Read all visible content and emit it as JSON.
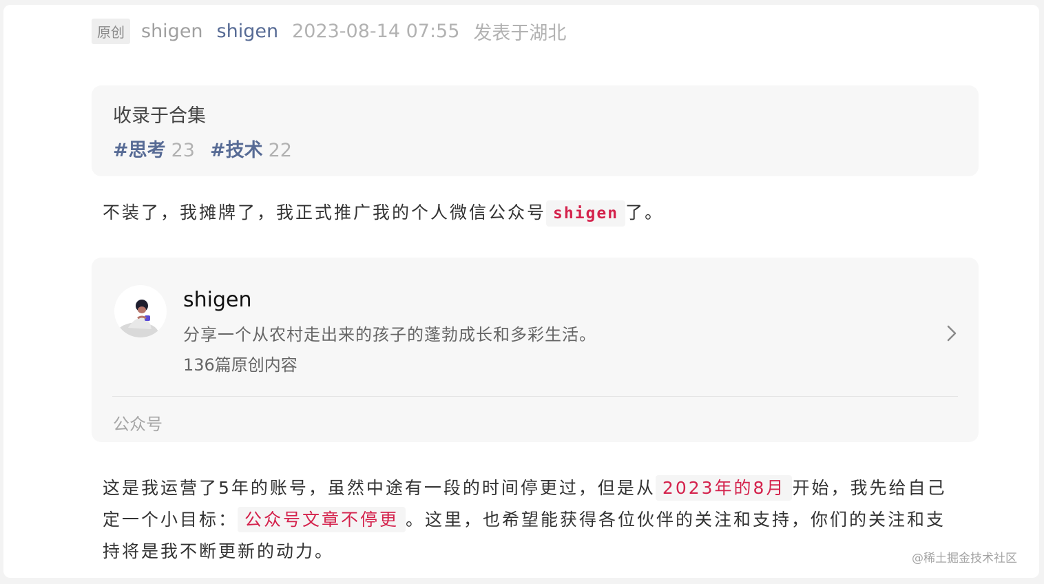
{
  "meta": {
    "badge": "原创",
    "author_plain": "shigen",
    "author_link": "shigen",
    "date": "2023-08-14 07:55",
    "location": "发表于湖北"
  },
  "collection": {
    "title": "收录于合集",
    "tags": [
      {
        "name": "#思考",
        "count": "23"
      },
      {
        "name": "#技术",
        "count": "22"
      }
    ]
  },
  "paragraph1": {
    "before": "不装了，我摊牌了，我正式推广我的个人微信公众号",
    "code": "shigen",
    "after": "了。"
  },
  "card": {
    "avatar_icon": "person-with-cup-avatar",
    "name": "shigen",
    "description": "分享一个从农村走出来的孩子的蓬勃成长和多彩生活。",
    "article_count": "136篇原创内容",
    "chevron_icon": "chevron-right-icon",
    "footer": "公众号"
  },
  "paragraph2": {
    "part1": "这是我运营了5年的账号，虽然中途有一段的时间停更过，但是从",
    "highlight1": "2023年的8月",
    "part2": "开始，我先给自己定一个小目标：",
    "highlight2": "公众号文章不停更",
    "part3": "。这里，也希望能获得各位伙伴的关注和支持，你们的关注和支持将是我不断更新的动力。"
  },
  "watermark": "@稀土掘金技术社区",
  "colors": {
    "link_blue": "#576b95",
    "highlight_red": "#d4224c",
    "card_bg": "#f7f7f7"
  }
}
